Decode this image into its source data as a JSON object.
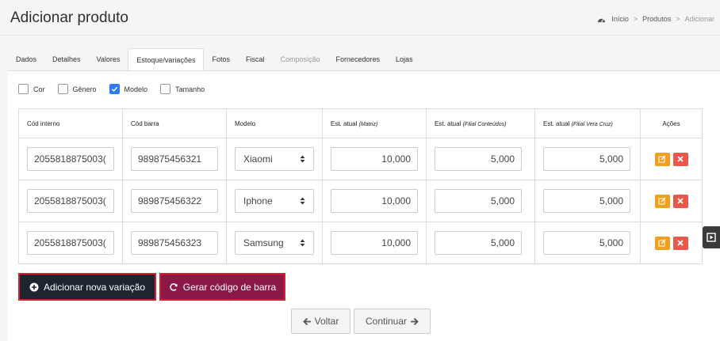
{
  "header": {
    "title": "Adicionar produto",
    "breadcrumb": [
      "Início",
      "Produtos",
      "Adicionar"
    ],
    "breadcrumb_sep": ">"
  },
  "tabs": [
    {
      "label": "Dados",
      "state": "normal"
    },
    {
      "label": "Detalhes",
      "state": "normal"
    },
    {
      "label": "Valores",
      "state": "normal"
    },
    {
      "label": "Estoque/variações",
      "state": "active"
    },
    {
      "label": "Fotos",
      "state": "normal"
    },
    {
      "label": "Fiscal",
      "state": "normal"
    },
    {
      "label": "Composição",
      "state": "disabled"
    },
    {
      "label": "Fornecedores",
      "state": "normal"
    },
    {
      "label": "Lojas",
      "state": "normal"
    }
  ],
  "variation_filters": [
    {
      "label": "Cor",
      "checked": false
    },
    {
      "label": "Gênero",
      "checked": false
    },
    {
      "label": "Modelo",
      "checked": true
    },
    {
      "label": "Tamanho",
      "checked": false
    }
  ],
  "table": {
    "headers": {
      "internal_code": "Cód interno",
      "barcode": "Cód barra",
      "model": "Modelo",
      "stock_matriz": "Est. atual",
      "stock_matriz_sub": "(Matriz)",
      "stock_conteudos": "Est. atual",
      "stock_conteudos_sub": "(Filial Conteúdos)",
      "stock_vera": "Est. atual",
      "stock_vera_sub": "(Filial Vera Cruz)",
      "actions": "Ações"
    },
    "rows": [
      {
        "internal_code": "2055818875003(",
        "barcode": "989875456321",
        "model": "Xiaomi",
        "stock_matriz": "10,000",
        "stock_conteudos": "5,000",
        "stock_vera": "5,000"
      },
      {
        "internal_code": "2055818875003(",
        "barcode": "989875456322",
        "model": "Iphone",
        "stock_matriz": "10,000",
        "stock_conteudos": "5,000",
        "stock_vera": "5,000"
      },
      {
        "internal_code": "2055818875003(",
        "barcode": "989875456323",
        "model": "Samsung",
        "stock_matriz": "10,000",
        "stock_conteudos": "5,000",
        "stock_vera": "5,000"
      }
    ]
  },
  "buttons": {
    "add_variation": "Adicionar nova variação",
    "generate_barcode": "Gerar código de barra",
    "back": "Voltar",
    "continue": "Continuar"
  },
  "colors": {
    "checkbox_checked": "#2d7cf6",
    "edit_button": "#f0a020",
    "delete_button": "#e9584a",
    "add_button_bg": "#1c2530",
    "generate_button_bg": "#8b1847",
    "highlight_border": "#d5202d"
  },
  "icons": {
    "breadcrumb_home": "tachometer-icon",
    "add": "plus-circle-icon",
    "generate": "refresh-icon",
    "back": "arrow-left-icon",
    "continue": "arrow-right-icon",
    "edit": "edit-icon",
    "delete": "close-icon",
    "select": "sort-caret-icon",
    "side_widget": "play-square-icon"
  }
}
